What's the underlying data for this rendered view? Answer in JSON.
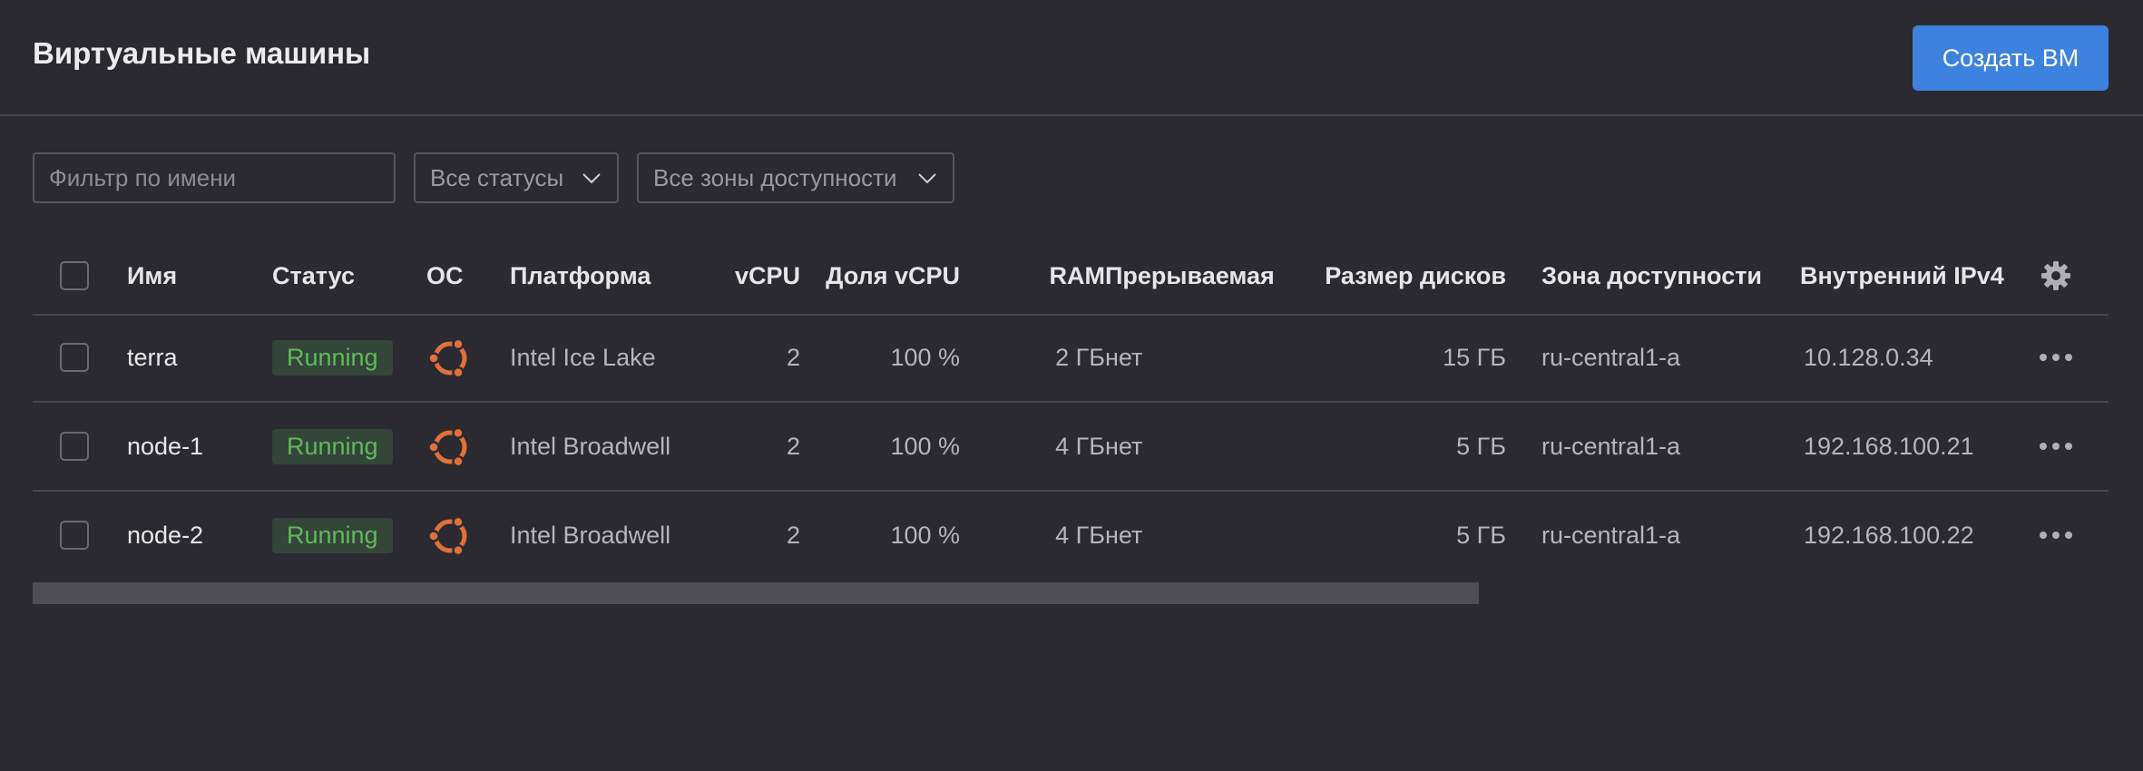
{
  "header": {
    "title": "Виртуальные машины",
    "create_button": "Создать ВМ"
  },
  "filters": {
    "name_placeholder": "Фильтр по имени",
    "status_select": "Все статусы",
    "zone_select": "Все зоны доступности"
  },
  "table": {
    "columns": {
      "name": "Имя",
      "status": "Статус",
      "os": "ОС",
      "platform": "Платформа",
      "vcpu": "vCPU",
      "vcpu_share": "Доля vCPU",
      "ram": "RAM",
      "preemptible": "Прерываемая",
      "disk_size": "Размер дисков",
      "zone": "Зона доступности",
      "ipv4": "Внутренний IPv4"
    },
    "rows": [
      {
        "name": "terra",
        "status": "Running",
        "os_icon": "ubuntu-icon",
        "platform": "Intel Ice Lake",
        "vcpu": "2",
        "vcpu_share": "100 %",
        "ram": "2 ГБ",
        "preemptible": "нет",
        "disk_size": "15 ГБ",
        "zone": "ru-central1-a",
        "ipv4": "10.128.0.34"
      },
      {
        "name": "node-1",
        "status": "Running",
        "os_icon": "ubuntu-icon",
        "platform": "Intel Broadwell",
        "vcpu": "2",
        "vcpu_share": "100 %",
        "ram": "4 ГБ",
        "preemptible": "нет",
        "disk_size": "5 ГБ",
        "zone": "ru-central1-a",
        "ipv4": "192.168.100.21"
      },
      {
        "name": "node-2",
        "status": "Running",
        "os_icon": "ubuntu-icon",
        "platform": "Intel Broadwell",
        "vcpu": "2",
        "vcpu_share": "100 %",
        "ram": "4 ГБ",
        "preemptible": "нет",
        "disk_size": "5 ГБ",
        "zone": "ru-central1-a",
        "ipv4": "192.168.100.22"
      }
    ]
  },
  "colors": {
    "background": "#2b2a30",
    "accent": "#3e82e0",
    "running_text": "#5fba5a",
    "ubuntu_orange": "#e2703a"
  }
}
